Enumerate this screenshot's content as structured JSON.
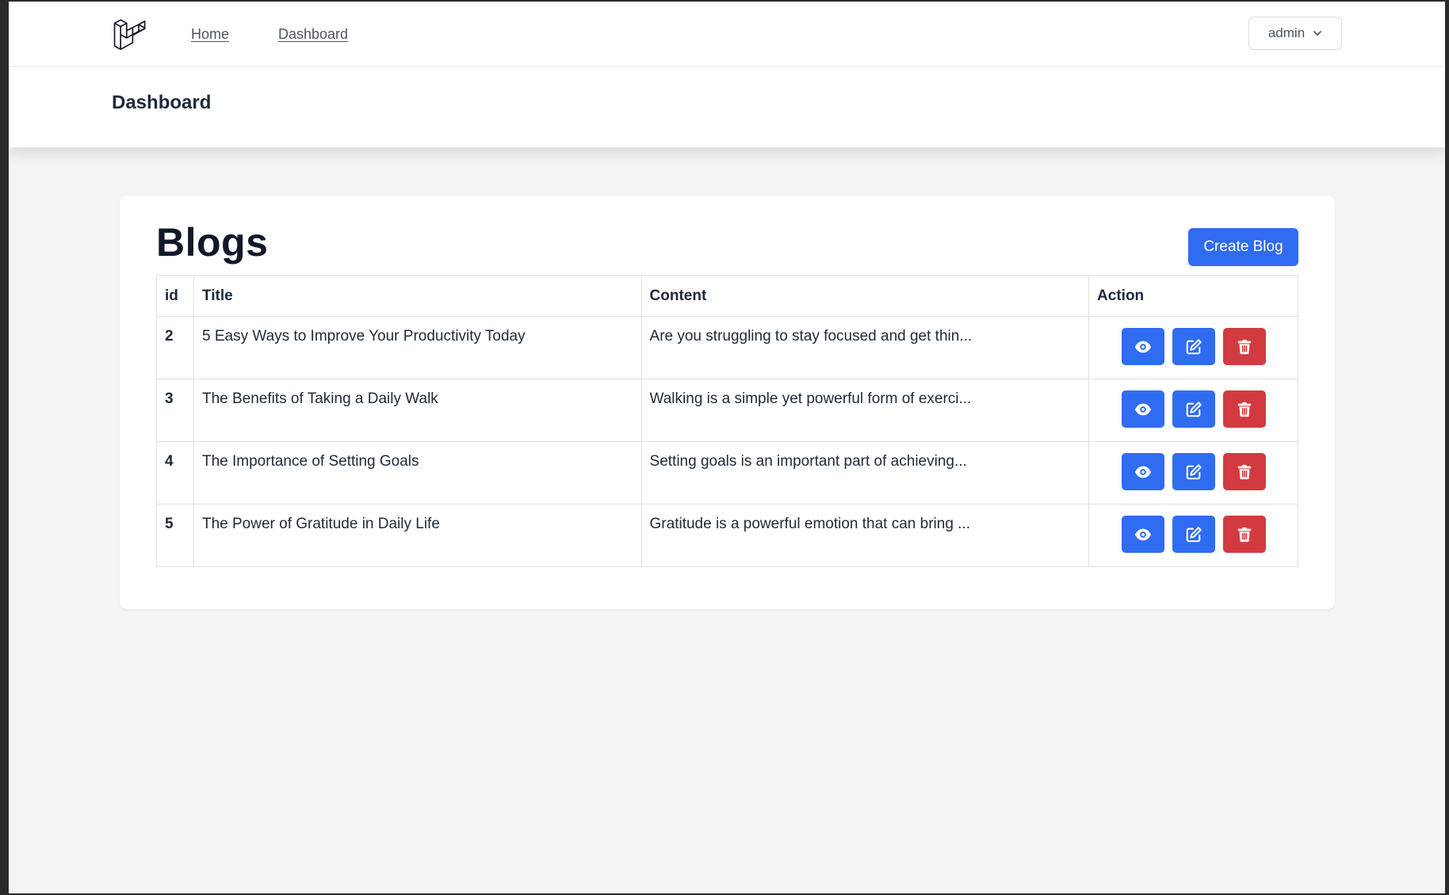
{
  "nav": {
    "links": [
      {
        "label": "Home"
      },
      {
        "label": "Dashboard"
      }
    ],
    "user": {
      "name": "admin",
      "icon": "chevron-down-icon"
    },
    "logo_icon": "laravel-logo-icon"
  },
  "header": {
    "title": "Dashboard"
  },
  "blogs": {
    "title": "Blogs",
    "create_label": "Create Blog",
    "columns": [
      "id",
      "Title",
      "Content",
      "Action"
    ],
    "rows": [
      {
        "id": "2",
        "title": "5 Easy Ways to Improve Your Productivity Today",
        "content": "Are you struggling to stay focused and get thin..."
      },
      {
        "id": "3",
        "title": "The Benefits of Taking a Daily Walk",
        "content": "Walking is a simple yet powerful form of exerci..."
      },
      {
        "id": "4",
        "title": "The Importance of Setting Goals",
        "content": "Setting goals is an important part of achieving..."
      },
      {
        "id": "5",
        "title": "The Power of Gratitude in Daily Life",
        "content": "Gratitude is a powerful emotion that can bring ..."
      }
    ],
    "action_icons": [
      "eye-icon",
      "edit-icon",
      "trash-icon"
    ]
  },
  "colors": {
    "primary": "#2f6cf1",
    "danger": "#d33a3f",
    "page_background": "#f3f4f6"
  }
}
